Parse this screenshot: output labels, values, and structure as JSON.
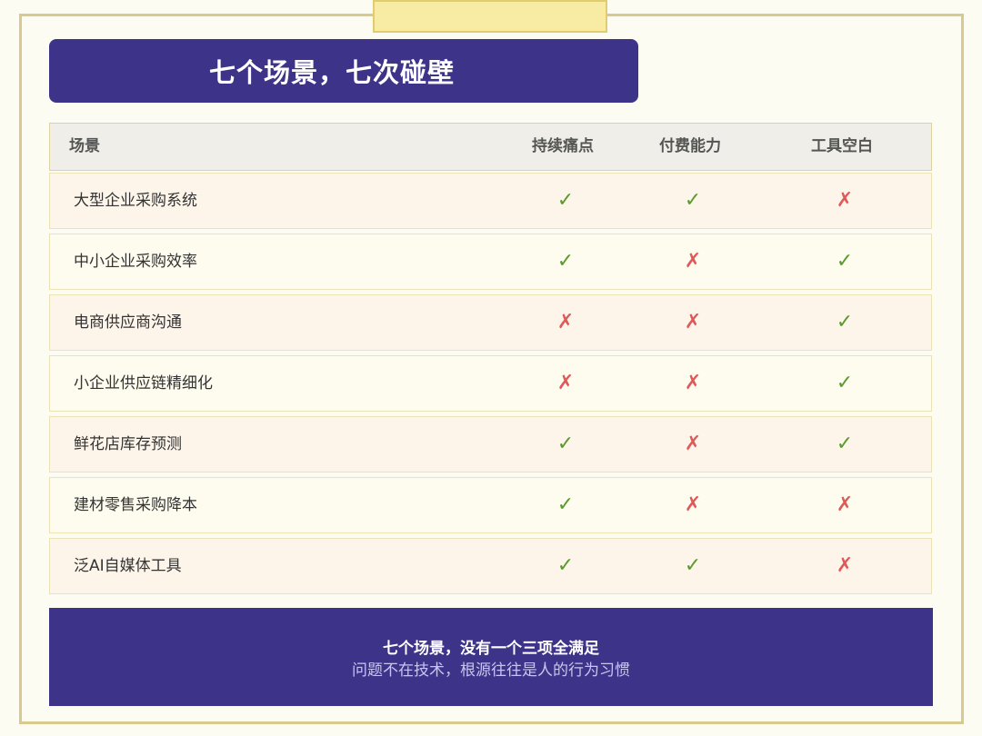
{
  "title": "七个场景，七次碰壁",
  "table": {
    "headers": {
      "scene": "场景",
      "pain": "持续痛点",
      "pay": "付费能力",
      "gap": "工具空白"
    },
    "rows": [
      {
        "scene": "大型企业采购系统",
        "pain": "✓",
        "pay": "✓",
        "gap": "✗"
      },
      {
        "scene": "中小企业采购效率",
        "pain": "✓",
        "pay": "✗",
        "gap": "✓"
      },
      {
        "scene": "电商供应商沟通",
        "pain": "✗",
        "pay": "✗",
        "gap": "✓"
      },
      {
        "scene": "小企业供应链精细化",
        "pain": "✗",
        "pay": "✗",
        "gap": "✓"
      },
      {
        "scene": "鲜花店库存预测",
        "pain": "✓",
        "pay": "✗",
        "gap": "✓"
      },
      {
        "scene": "建材零售采购降本",
        "pain": "✓",
        "pay": "✗",
        "gap": "✗"
      },
      {
        "scene": "泛AI自媒体工具",
        "pain": "✓",
        "pay": "✓",
        "gap": "✗"
      }
    ]
  },
  "footer": {
    "main": "七个场景，没有一个三项全满足",
    "sub": "问题不在技术，根源往往是人的行为习惯"
  },
  "colors": {
    "accent": "#3d3389",
    "check": "#5a9a2e",
    "cross": "#de5a5a",
    "frame": "#d9c98f",
    "tape": "#f8eca5"
  }
}
